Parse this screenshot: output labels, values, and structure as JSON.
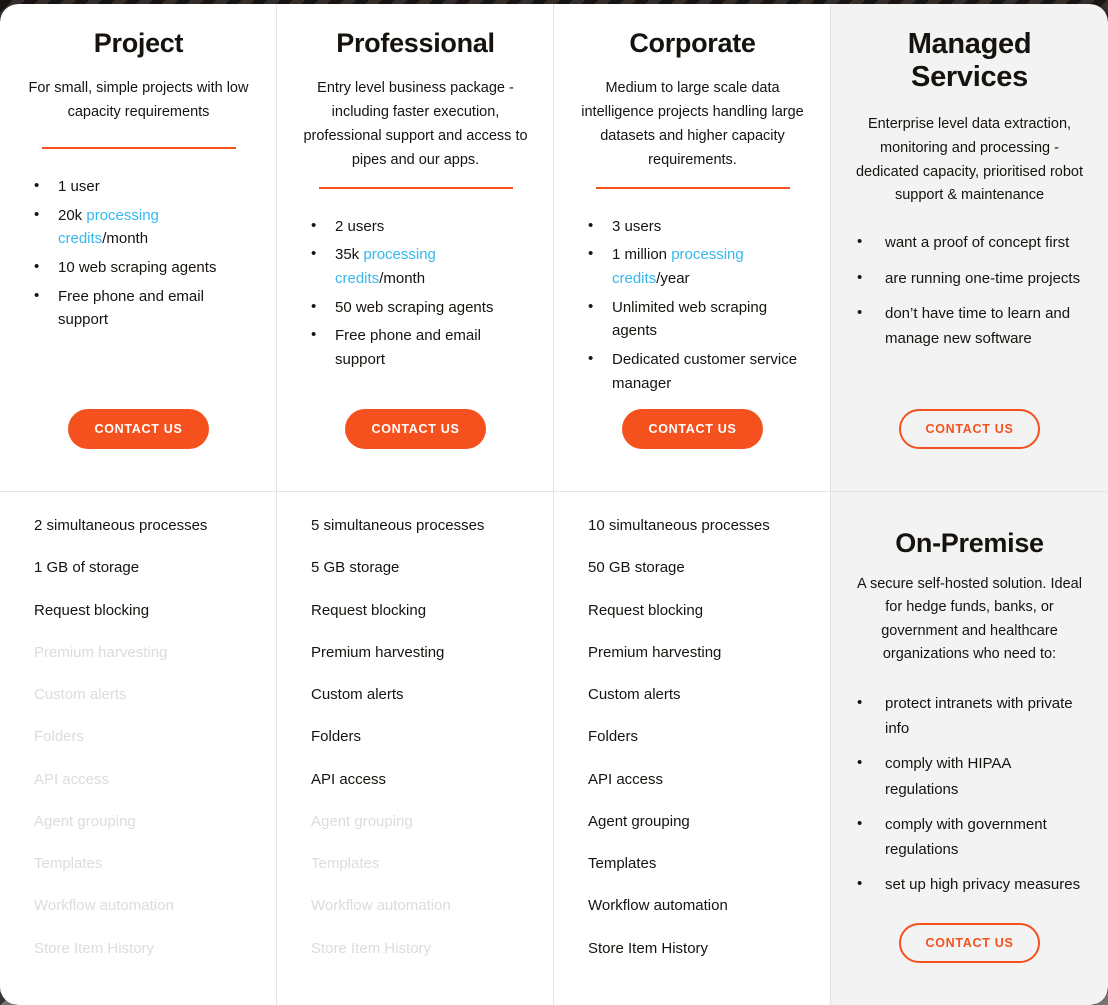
{
  "theme": {
    "accent": "#f4511e",
    "link": "#35b8ee",
    "text": "#17130f",
    "disabled_text": "#dcdcdc",
    "card_bg": "#ffffff",
    "highlight_card_bg": "#f3f3f3",
    "divider": "#e3e3e3",
    "backdrop": "#5d5754"
  },
  "plans": [
    {
      "id": "project",
      "title": "Project",
      "description": "For small, simple projects with low capacity requirements",
      "highlights": [
        {
          "pre": "1 user",
          "link": "",
          "post": ""
        },
        {
          "pre": "20k ",
          "link": "processing credits",
          "post": "/month"
        },
        {
          "pre": "10 web scraping agents",
          "link": "",
          "post": ""
        },
        {
          "pre": "Free phone and email support",
          "link": "",
          "post": ""
        }
      ],
      "cta": "CONTACT US",
      "cta_style": "filled",
      "features": [
        {
          "label": "2 simultaneous processes",
          "enabled": true
        },
        {
          "label": "1 GB of storage",
          "enabled": true
        },
        {
          "label": "Request blocking",
          "enabled": true
        },
        {
          "label": "Premium harvesting",
          "enabled": false
        },
        {
          "label": "Custom alerts",
          "enabled": false
        },
        {
          "label": "Folders",
          "enabled": false
        },
        {
          "label": "API access",
          "enabled": false
        },
        {
          "label": "Agent grouping",
          "enabled": false
        },
        {
          "label": "Templates",
          "enabled": false
        },
        {
          "label": "Workflow automation",
          "enabled": false
        },
        {
          "label": "Store Item History",
          "enabled": false
        }
      ]
    },
    {
      "id": "professional",
      "title": "Professional",
      "description": "Entry level business package - including faster execution, professional support and access to pipes and our apps.",
      "highlights": [
        {
          "pre": "2 users",
          "link": "",
          "post": ""
        },
        {
          "pre": "35k ",
          "link": "processing credits",
          "post": "/month"
        },
        {
          "pre": "50 web scraping agents",
          "link": "",
          "post": ""
        },
        {
          "pre": "Free phone and email support",
          "link": "",
          "post": ""
        }
      ],
      "cta": "CONTACT US",
      "cta_style": "filled",
      "features": [
        {
          "label": "5 simultaneous processes",
          "enabled": true
        },
        {
          "label": "5 GB storage",
          "enabled": true
        },
        {
          "label": "Request blocking",
          "enabled": true
        },
        {
          "label": "Premium harvesting",
          "enabled": true
        },
        {
          "label": "Custom alerts",
          "enabled": true
        },
        {
          "label": "Folders",
          "enabled": true
        },
        {
          "label": "API access",
          "enabled": true
        },
        {
          "label": "Agent grouping",
          "enabled": false
        },
        {
          "label": "Templates",
          "enabled": false
        },
        {
          "label": "Workflow automation",
          "enabled": false
        },
        {
          "label": "Store Item History",
          "enabled": false
        }
      ]
    },
    {
      "id": "corporate",
      "title": "Corporate",
      "description": "Medium to large scale data intelligence projects handling large datasets and higher capacity requirements.",
      "highlights": [
        {
          "pre": "3 users",
          "link": "",
          "post": ""
        },
        {
          "pre": "1 million ",
          "link": "processing credits",
          "post": "/year"
        },
        {
          "pre": "Unlimited web scraping agents",
          "link": "",
          "post": ""
        },
        {
          "pre": "Dedicated customer service manager",
          "link": "",
          "post": ""
        }
      ],
      "cta": "CONTACT US",
      "cta_style": "filled",
      "features": [
        {
          "label": "10 simultaneous processes",
          "enabled": true
        },
        {
          "label": "50 GB storage",
          "enabled": true
        },
        {
          "label": "Request blocking",
          "enabled": true
        },
        {
          "label": "Premium harvesting",
          "enabled": true
        },
        {
          "label": "Custom alerts",
          "enabled": true
        },
        {
          "label": "Folders",
          "enabled": true
        },
        {
          "label": "API access",
          "enabled": true
        },
        {
          "label": "Agent grouping",
          "enabled": true
        },
        {
          "label": "Templates",
          "enabled": true
        },
        {
          "label": "Workflow automation",
          "enabled": true
        },
        {
          "label": "Store Item History",
          "enabled": true
        }
      ]
    }
  ],
  "managed": {
    "title": "Managed Services",
    "description": "Enterprise level data extraction, monitoring and processing - dedicated capacity, prioritised robot support & maintenance",
    "intro_bullets": [
      "want a proof of concept first",
      "are running one-time projects",
      "don’t have time to learn and manage new software"
    ],
    "cta": "CONTACT US",
    "onprem": {
      "title": "On-Premise",
      "description": "A secure self-hosted solution. Ideal for hedge funds, banks, or government and healthcare organizations who need to:",
      "bullets": [
        "protect intranets with private info",
        "comply with HIPAA regulations",
        "comply with government regulations",
        "set up high privacy measures"
      ],
      "cta": "CONTACT US"
    }
  }
}
